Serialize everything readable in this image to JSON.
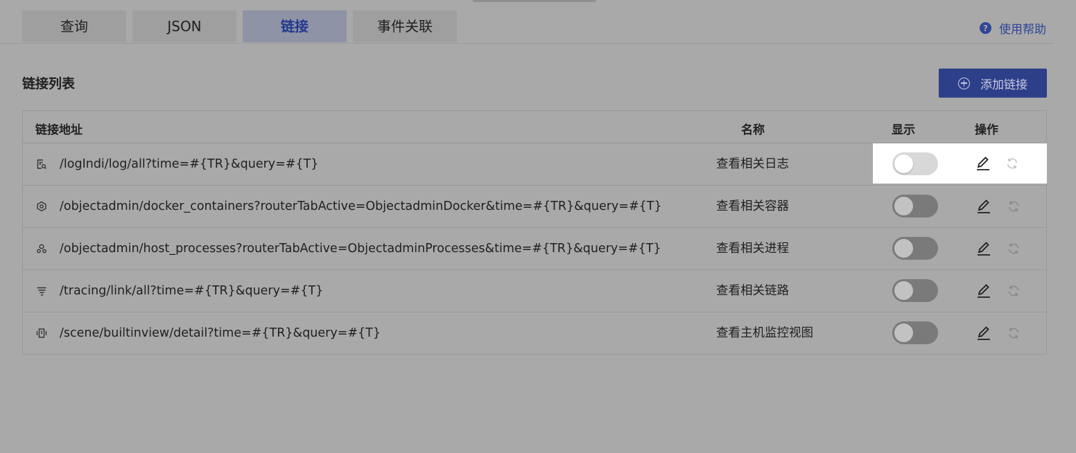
{
  "tabs": [
    {
      "label": "查询",
      "active": false
    },
    {
      "label": "JSON",
      "active": false
    },
    {
      "label": "链接",
      "active": true
    },
    {
      "label": "事件关联",
      "active": false
    }
  ],
  "help": {
    "label": "使用帮助",
    "icon": "question-circle-icon"
  },
  "section": {
    "title": "链接列表"
  },
  "add_button": {
    "label": "添加链接",
    "icon": "plus-circle-icon"
  },
  "table": {
    "columns": [
      "链接地址",
      "名称",
      "显示",
      "操作"
    ],
    "rows": [
      {
        "icon": "log-search-icon",
        "url": "/logIndi/log/all?time=#{TR}&query=#{T}",
        "name": "查看相关日志",
        "shown": false
      },
      {
        "icon": "hexagon-icon",
        "url": "/objectadmin/docker_containers?routerTabActive=ObjectadminDocker&time=#{TR}&query=#{T}",
        "name": "查看相关容器",
        "shown": false
      },
      {
        "icon": "process-icon",
        "url": "/objectadmin/host_processes?routerTabActive=ObjectadminProcesses&time=#{TR}&query=#{T}",
        "name": "查看相关进程",
        "shown": false
      },
      {
        "icon": "trace-list-icon",
        "url": "/tracing/link/all?time=#{TR}&query=#{T}",
        "name": "查看相关链路",
        "shown": false
      },
      {
        "icon": "host-view-icon",
        "url": "/scene/builtinview/detail?time=#{TR}&query=#{T}",
        "name": "查看主机监控视图",
        "shown": false
      }
    ]
  },
  "colors": {
    "overlay": "#a9a9a9",
    "accent": "#2e3f8a",
    "highlight": "#ffffff"
  }
}
